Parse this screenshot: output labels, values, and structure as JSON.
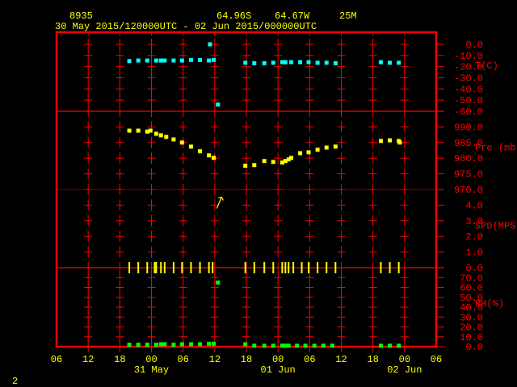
{
  "header": {
    "station": "8935",
    "lat": "64.96S",
    "lon": "64.67W",
    "elev": "25M",
    "period": "30 May 2015/120000UTC - 02 Jun 2015/000000UTC"
  },
  "page_number": "2",
  "colors": {
    "frame": "#ff0000",
    "text": "#ffff00",
    "temp": "#00ffff",
    "pres": "#ffff00",
    "spd": "#ffff00",
    "rh": "#00ff00"
  },
  "chart_data": {
    "type": "scatter",
    "time_unit": "hours since 30 May 2015 06 UTC",
    "xlim": [
      0,
      72
    ],
    "x_tick_labels": [
      "06",
      "12",
      "18",
      "00",
      "06",
      "12",
      "18",
      "00",
      "06",
      "12",
      "18",
      "00",
      "06"
    ],
    "date_labels": [
      {
        "label": "31 May",
        "hour": 18
      },
      {
        "label": "01 Jun",
        "hour": 42
      },
      {
        "label": "02 Jun",
        "hour": 66
      }
    ],
    "panels": [
      {
        "name": "T(C)",
        "color": "#00ffff",
        "ylim": [
          -60,
          10
        ],
        "ticks": [
          "0.0",
          "-10.0",
          "-20.0",
          "-30.0",
          "-40.0",
          "-50.0",
          "-60.0"
        ],
        "tick_values": [
          0,
          -10,
          -20,
          -30,
          -40,
          -50,
          -60
        ],
        "points": [
          [
            13.8,
            -15
          ],
          [
            15.5,
            -14.5
          ],
          [
            17.2,
            -14.5
          ],
          [
            18.9,
            -14.5
          ],
          [
            19.8,
            -14.5
          ],
          [
            20.5,
            -14.5
          ],
          [
            22.2,
            -14.5
          ],
          [
            23.8,
            -14.5
          ],
          [
            25.5,
            -14
          ],
          [
            27.2,
            -14
          ],
          [
            28.9,
            -14.5
          ],
          [
            29.8,
            -14
          ],
          [
            29.1,
            0
          ],
          [
            30.6,
            -54
          ],
          [
            35.8,
            -16.5
          ],
          [
            37.5,
            -17
          ],
          [
            39.4,
            -17
          ],
          [
            41.1,
            -16.5
          ],
          [
            42.8,
            -16
          ],
          [
            43.4,
            -16
          ],
          [
            44.5,
            -16
          ],
          [
            46.2,
            -16
          ],
          [
            47.8,
            -16
          ],
          [
            49.5,
            -16.5
          ],
          [
            51.2,
            -16.5
          ],
          [
            52.9,
            -17
          ],
          [
            61.5,
            -16
          ],
          [
            63.2,
            -16.5
          ],
          [
            64.9,
            -16.5
          ]
        ]
      },
      {
        "name": "Pre (mb)",
        "color": "#ffff00",
        "ylim": [
          970,
          995
        ],
        "ticks": [
          "990.0",
          "985.0",
          "980.0",
          "975.0",
          "970.0"
        ],
        "tick_values": [
          990,
          985,
          980,
          975,
          970
        ],
        "points": [
          [
            13.8,
            988.8
          ],
          [
            15.5,
            988.8
          ],
          [
            17.2,
            988.5
          ],
          [
            17.8,
            988.8
          ],
          [
            18.9,
            987.8
          ],
          [
            19.8,
            987.3
          ],
          [
            20.8,
            986.8
          ],
          [
            22.2,
            986
          ],
          [
            23.8,
            985
          ],
          [
            25.5,
            983.7
          ],
          [
            27.2,
            982.2
          ],
          [
            28.9,
            980.9
          ],
          [
            29.8,
            980.1
          ],
          [
            35.8,
            977.6
          ],
          [
            37.5,
            977.8
          ],
          [
            39.4,
            979.1
          ],
          [
            41.1,
            978.8
          ],
          [
            42.8,
            978.6
          ],
          [
            43.4,
            979.1
          ],
          [
            44,
            979.6
          ],
          [
            44.5,
            980.1
          ],
          [
            46.2,
            981.6
          ],
          [
            47.8,
            981.9
          ],
          [
            49.5,
            982.7
          ],
          [
            51.2,
            983.4
          ],
          [
            52.9,
            983.7
          ],
          [
            61.5,
            985.5
          ],
          [
            63.2,
            985.7
          ],
          [
            64.9,
            985.5
          ],
          [
            65.1,
            985
          ]
        ]
      },
      {
        "name": "SPD(MPS)",
        "color": "#ffff00",
        "ylim": [
          0,
          5
        ],
        "ticks": [
          "4.0",
          "3.0",
          "2.0",
          "1.0",
          "0.0"
        ],
        "tick_values": [
          4,
          3,
          2,
          1,
          0
        ],
        "points": [
          [
            13.8,
            0
          ],
          [
            15.5,
            0
          ],
          [
            17.2,
            0
          ],
          [
            18.6,
            0
          ],
          [
            18.9,
            0
          ],
          [
            19.8,
            0
          ],
          [
            20.5,
            0
          ],
          [
            22.2,
            0
          ],
          [
            23.8,
            0
          ],
          [
            25.5,
            0
          ],
          [
            27.2,
            0
          ],
          [
            28.9,
            0
          ],
          [
            29.6,
            0
          ],
          [
            35.8,
            0
          ],
          [
            37.5,
            0
          ],
          [
            39.4,
            0
          ],
          [
            41.1,
            0
          ],
          [
            42.8,
            0
          ],
          [
            43.4,
            0
          ],
          [
            44,
            0
          ],
          [
            44.9,
            0
          ],
          [
            46.5,
            0
          ],
          [
            47.8,
            0
          ],
          [
            49.5,
            0
          ],
          [
            51.2,
            0
          ],
          [
            52.9,
            0
          ],
          [
            61.5,
            0
          ],
          [
            63.2,
            0
          ],
          [
            64.9,
            0
          ]
        ],
        "arrow": {
          "hour": 31,
          "value": 4.2
        }
      },
      {
        "name": "RH(%)",
        "color": "#00ff00",
        "ylim": [
          0,
          80
        ],
        "ticks": [
          "70.0",
          "60.0",
          "50.0",
          "40.0",
          "30.0",
          "20.0",
          "10.0",
          "0.0"
        ],
        "tick_values": [
          70,
          60,
          50,
          40,
          30,
          20,
          10,
          0
        ],
        "points": [
          [
            13.8,
            2
          ],
          [
            15.5,
            2
          ],
          [
            17.2,
            2
          ],
          [
            18.9,
            2
          ],
          [
            19.8,
            2.5
          ],
          [
            20.5,
            2.5
          ],
          [
            22.2,
            2
          ],
          [
            23.8,
            2.5
          ],
          [
            25.5,
            2.5
          ],
          [
            27.2,
            2.5
          ],
          [
            28.9,
            3
          ],
          [
            29.8,
            3
          ],
          [
            30.6,
            65
          ],
          [
            35.8,
            2.5
          ],
          [
            37.5,
            1
          ],
          [
            39.4,
            1
          ],
          [
            41.1,
            1
          ],
          [
            42.8,
            1
          ],
          [
            43.4,
            1
          ],
          [
            44,
            1
          ],
          [
            45.6,
            1
          ],
          [
            47.2,
            1
          ],
          [
            48.9,
            1
          ],
          [
            50.6,
            1
          ],
          [
            52.3,
            1
          ],
          [
            61.5,
            1
          ],
          [
            63.2,
            1
          ],
          [
            64.9,
            1
          ]
        ]
      }
    ]
  }
}
